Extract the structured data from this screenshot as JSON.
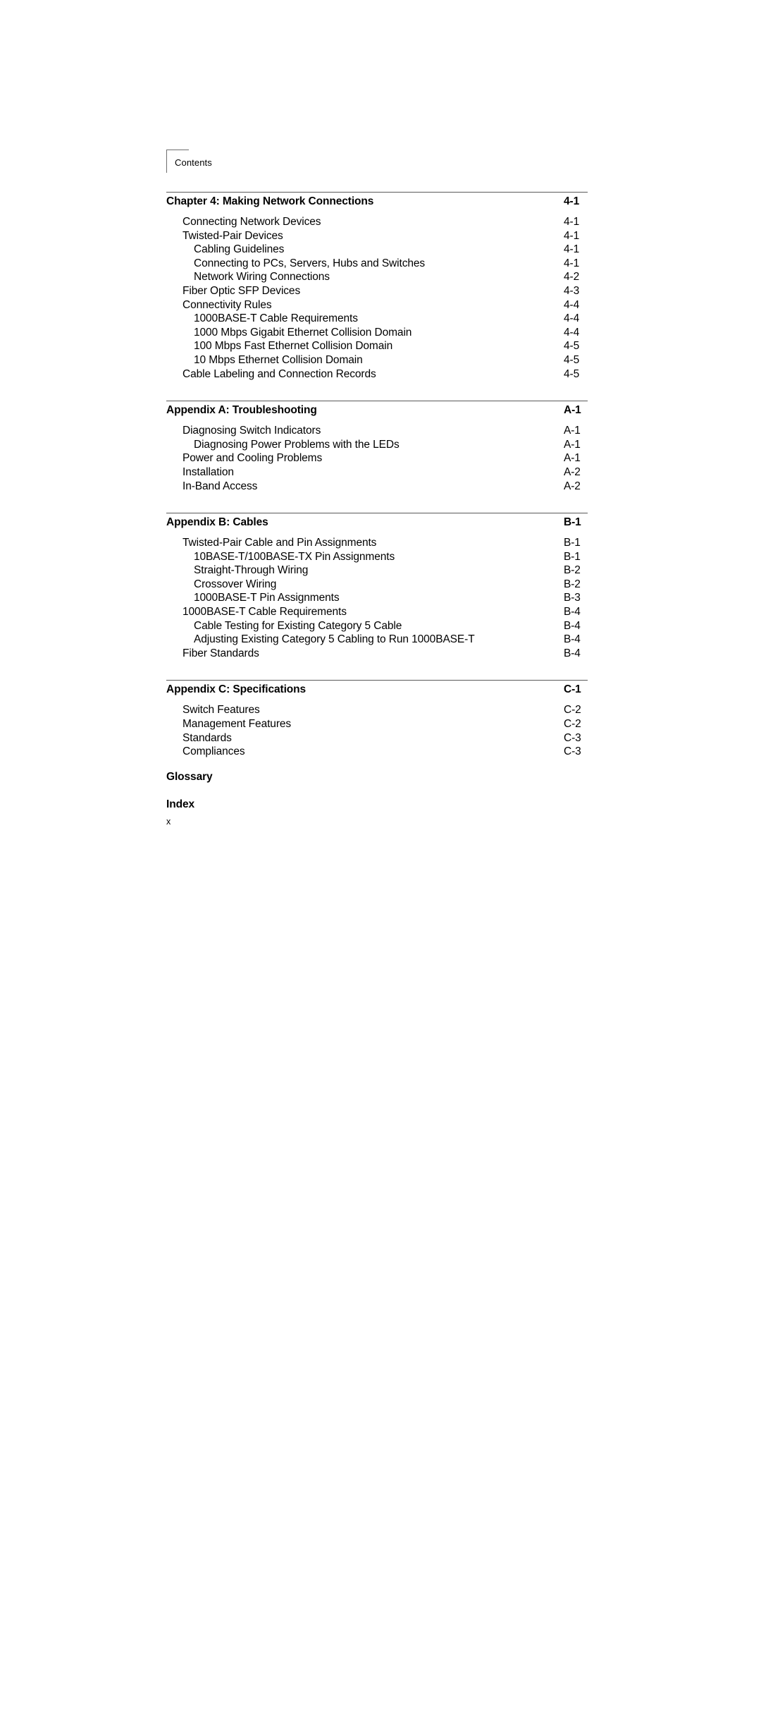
{
  "header": {
    "label": "Contents"
  },
  "folio": "x",
  "sections": [
    {
      "id": "chapter-4",
      "has_rule": true,
      "heading": {
        "label": "Chapter 4: Making Network Connections",
        "page": "4-1"
      },
      "entries": [
        {
          "level": 1,
          "label": "Connecting Network Devices",
          "page": "4-1"
        },
        {
          "level": 1,
          "label": "Twisted-Pair Devices",
          "page": "4-1"
        },
        {
          "level": 2,
          "label": "Cabling Guidelines",
          "page": "4-1"
        },
        {
          "level": 2,
          "label": "Connecting to PCs, Servers, Hubs and Switches",
          "page": "4-1"
        },
        {
          "level": 2,
          "label": "Network Wiring Connections",
          "page": "4-2"
        },
        {
          "level": 1,
          "label": "Fiber Optic SFP Devices",
          "page": "4-3"
        },
        {
          "level": 1,
          "label": "Connectivity Rules",
          "page": "4-4"
        },
        {
          "level": 2,
          "label": "1000BASE-T Cable Requirements",
          "page": "4-4"
        },
        {
          "level": 2,
          "label": "1000 Mbps Gigabit Ethernet Collision Domain",
          "page": "4-4"
        },
        {
          "level": 2,
          "label": "100 Mbps Fast Ethernet Collision Domain",
          "page": "4-5"
        },
        {
          "level": 2,
          "label": "10 Mbps Ethernet Collision Domain",
          "page": "4-5"
        },
        {
          "level": 1,
          "label": "Cable Labeling and Connection Records",
          "page": "4-5"
        }
      ]
    },
    {
      "id": "appendix-a",
      "has_rule": true,
      "heading": {
        "label": "Appendix A: Troubleshooting",
        "page": "A-1"
      },
      "entries": [
        {
          "level": 1,
          "label": "Diagnosing Switch Indicators",
          "page": "A-1"
        },
        {
          "level": 2,
          "label": "Diagnosing Power Problems with the LEDs",
          "page": "A-1"
        },
        {
          "level": 1,
          "label": "Power and Cooling Problems",
          "page": "A-1"
        },
        {
          "level": 1,
          "label": "Installation",
          "page": "A-2"
        },
        {
          "level": 1,
          "label": "In-Band Access",
          "page": "A-2"
        }
      ]
    },
    {
      "id": "appendix-b",
      "has_rule": true,
      "heading": {
        "label": "Appendix B: Cables",
        "page": "B-1"
      },
      "entries": [
        {
          "level": 1,
          "label": "Twisted-Pair Cable and Pin Assignments",
          "page": "B-1"
        },
        {
          "level": 2,
          "label": "10BASE-T/100BASE-TX Pin Assignments",
          "page": "B-1"
        },
        {
          "level": 2,
          "label": "Straight-Through Wiring",
          "page": "B-2"
        },
        {
          "level": 2,
          "label": "Crossover Wiring",
          "page": "B-2"
        },
        {
          "level": 2,
          "label": "1000BASE-T Pin Assignments",
          "page": "B-3"
        },
        {
          "level": 1,
          "label": "1000BASE-T Cable Requirements",
          "page": "B-4"
        },
        {
          "level": 2,
          "label": "Cable Testing for Existing Category 5 Cable",
          "page": "B-4"
        },
        {
          "level": 2,
          "label": "Adjusting Existing Category 5 Cabling to Run 1000BASE-T",
          "page": "B-4"
        },
        {
          "level": 1,
          "label": "Fiber Standards",
          "page": "B-4"
        }
      ]
    },
    {
      "id": "appendix-c",
      "has_rule": true,
      "heading": {
        "label": "Appendix C: Specifications",
        "page": "C-1"
      },
      "entries": [
        {
          "level": 1,
          "label": "Switch Features",
          "page": "C-2"
        },
        {
          "level": 1,
          "label": "Management Features",
          "page": "C-2"
        },
        {
          "level": 1,
          "label": "Standards",
          "page": "C-3"
        },
        {
          "level": 1,
          "label": "Compliances",
          "page": "C-3"
        }
      ]
    },
    {
      "id": "glossary",
      "has_rule": false,
      "heading": {
        "label": "Glossary",
        "page": ""
      },
      "entries": []
    },
    {
      "id": "index",
      "has_rule": false,
      "heading": {
        "label": "Index",
        "page": ""
      },
      "entries": []
    }
  ]
}
